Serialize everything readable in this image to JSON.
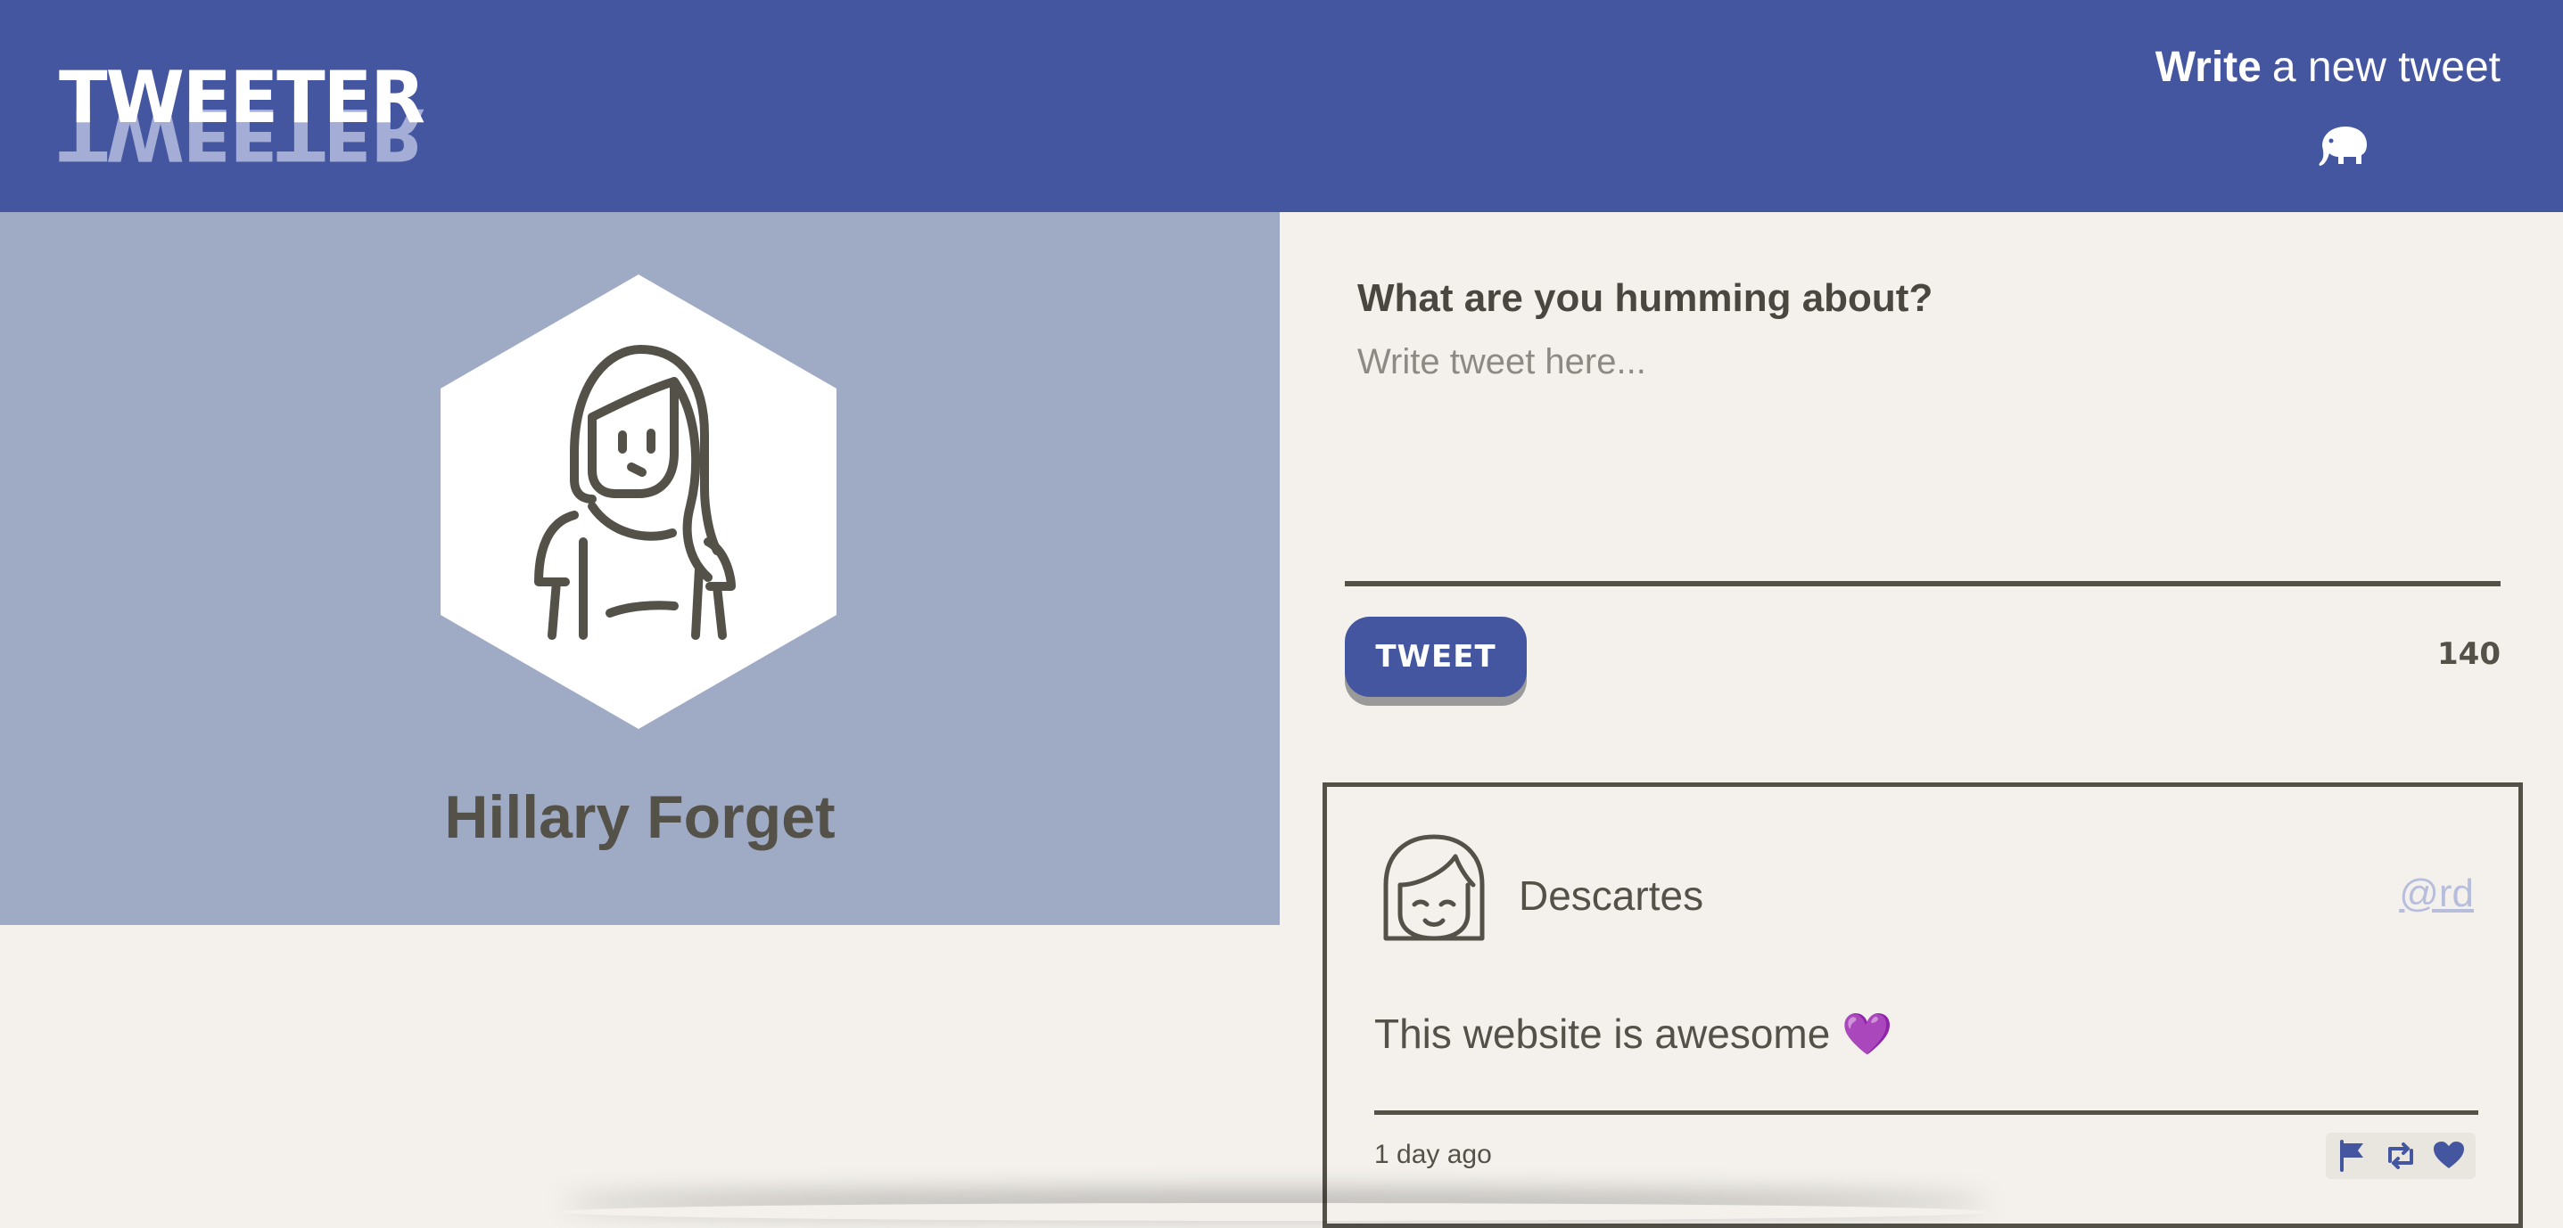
{
  "header": {
    "logo_text": "TWEETER",
    "write_bold": "Write",
    "write_rest": "a new tweet",
    "compose_icon": "elephant-icon"
  },
  "profile": {
    "name": "Hillary Forget",
    "avatar_icon": "woman-avatar-icon"
  },
  "compose": {
    "label": "What are you humming about?",
    "placeholder": "Write tweet here...",
    "button_label": "TWEET",
    "counter": "140"
  },
  "tweets": [
    {
      "author": "Descartes",
      "handle": "@rd",
      "body": "This website is awesome 💜",
      "time": "1 day ago",
      "avatar_icon": "girl-avatar-icon",
      "actions": [
        "flag-icon",
        "retweet-icon",
        "heart-icon"
      ]
    }
  ],
  "colors": {
    "header_bg": "#4556a0",
    "profile_bg": "#9faac4",
    "page_bg": "#f4f1ec",
    "text": "#545149",
    "handle": "#b7bedc"
  }
}
